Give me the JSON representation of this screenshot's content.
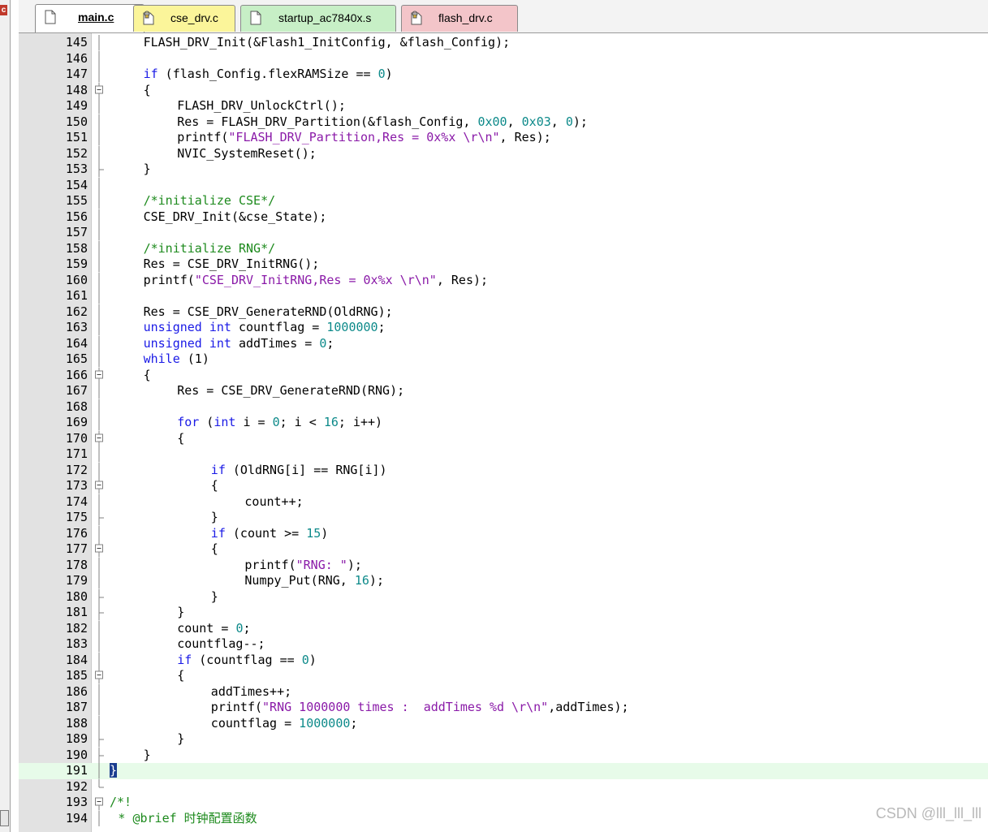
{
  "tabs": [
    {
      "label": "main.c",
      "active": true,
      "icon": "file-icon"
    },
    {
      "label": "cse_drv.c",
      "active": false,
      "icon": "locked-file-icon"
    },
    {
      "label": "startup_ac7840x.s",
      "active": false,
      "icon": "file-icon"
    },
    {
      "label": "flash_drv.c",
      "active": false,
      "icon": "locked-file-icon"
    }
  ],
  "left_badge": "c",
  "colors": {
    "keyword": "#1a1ae6",
    "number": "#0d8a8a",
    "string": "#8a1aa8",
    "comment": "#1d8a1d",
    "current_line": "#e7fbe9",
    "gutter": "#e2e2e2",
    "tab_active": "#ffffff",
    "tab_yellow": "#fbf59a",
    "tab_green": "#c7efc6",
    "tab_pink": "#f3c5c9"
  },
  "editor": {
    "current_line": 191,
    "lines": [
      {
        "n": 145,
        "fold": "line",
        "indent": 4,
        "code": [
          [
            "t",
            "FLASH_DRV_Init(&Flash1_InitConfig, &flash_Config);"
          ]
        ]
      },
      {
        "n": 146,
        "fold": "line",
        "indent": 0,
        "code": []
      },
      {
        "n": 147,
        "fold": "line",
        "indent": 4,
        "code": [
          [
            "k",
            "if"
          ],
          [
            "t",
            " (flash_Config.flexRAMSize == "
          ],
          [
            "n",
            "0"
          ],
          [
            "t",
            ")"
          ]
        ]
      },
      {
        "n": 148,
        "fold": "box",
        "indent": 4,
        "code": [
          [
            "t",
            "{"
          ]
        ]
      },
      {
        "n": 149,
        "fold": "line",
        "indent": 8,
        "code": [
          [
            "t",
            "FLASH_DRV_UnlockCtrl();"
          ]
        ]
      },
      {
        "n": 150,
        "fold": "line",
        "indent": 8,
        "code": [
          [
            "t",
            "Res = FLASH_DRV_Partition(&flash_Config, "
          ],
          [
            "n",
            "0x00"
          ],
          [
            "t",
            ", "
          ],
          [
            "n",
            "0x03"
          ],
          [
            "t",
            ", "
          ],
          [
            "n",
            "0"
          ],
          [
            "t",
            ");"
          ]
        ]
      },
      {
        "n": 151,
        "fold": "line",
        "indent": 8,
        "code": [
          [
            "t",
            "printf("
          ],
          [
            "s",
            "\"FLASH_DRV_Partition,Res = 0x%x \\r\\n\""
          ],
          [
            "t",
            ", Res);"
          ]
        ]
      },
      {
        "n": 152,
        "fold": "line",
        "indent": 8,
        "code": [
          [
            "t",
            "NVIC_SystemReset();"
          ]
        ]
      },
      {
        "n": 153,
        "fold": "end",
        "indent": 4,
        "code": [
          [
            "t",
            "}"
          ]
        ]
      },
      {
        "n": 154,
        "fold": "line",
        "indent": 0,
        "code": []
      },
      {
        "n": 155,
        "fold": "line",
        "indent": 4,
        "code": [
          [
            "c",
            "/*initialize CSE*/"
          ]
        ]
      },
      {
        "n": 156,
        "fold": "line",
        "indent": 4,
        "code": [
          [
            "t",
            "CSE_DRV_Init(&cse_State);"
          ]
        ]
      },
      {
        "n": 157,
        "fold": "line",
        "indent": 0,
        "code": []
      },
      {
        "n": 158,
        "fold": "line",
        "indent": 4,
        "code": [
          [
            "c",
            "/*initialize RNG*/"
          ]
        ]
      },
      {
        "n": 159,
        "fold": "line",
        "indent": 4,
        "code": [
          [
            "t",
            "Res = CSE_DRV_InitRNG();"
          ]
        ]
      },
      {
        "n": 160,
        "fold": "line",
        "indent": 4,
        "code": [
          [
            "t",
            "printf("
          ],
          [
            "s",
            "\"CSE_DRV_InitRNG,Res = 0x%x \\r\\n\""
          ],
          [
            "t",
            ", Res);"
          ]
        ]
      },
      {
        "n": 161,
        "fold": "line",
        "indent": 0,
        "code": []
      },
      {
        "n": 162,
        "fold": "line",
        "indent": 4,
        "code": [
          [
            "t",
            "Res = CSE_DRV_GenerateRND(OldRNG);"
          ]
        ]
      },
      {
        "n": 163,
        "fold": "line",
        "indent": 4,
        "code": [
          [
            "k",
            "unsigned int"
          ],
          [
            "t",
            " countflag = "
          ],
          [
            "n",
            "1000000"
          ],
          [
            "t",
            ";"
          ]
        ]
      },
      {
        "n": 164,
        "fold": "line",
        "indent": 4,
        "code": [
          [
            "k",
            "unsigned int"
          ],
          [
            "t",
            " addTimes = "
          ],
          [
            "n",
            "0"
          ],
          [
            "t",
            ";"
          ]
        ]
      },
      {
        "n": 165,
        "fold": "line",
        "indent": 4,
        "code": [
          [
            "k",
            "while"
          ],
          [
            "t",
            " (1)"
          ]
        ]
      },
      {
        "n": 166,
        "fold": "box",
        "indent": 4,
        "code": [
          [
            "t",
            "{"
          ]
        ]
      },
      {
        "n": 167,
        "fold": "line",
        "indent": 8,
        "code": [
          [
            "t",
            "Res = CSE_DRV_GenerateRND(RNG);"
          ]
        ]
      },
      {
        "n": 168,
        "fold": "line",
        "indent": 0,
        "code": []
      },
      {
        "n": 169,
        "fold": "line",
        "indent": 8,
        "code": [
          [
            "k",
            "for"
          ],
          [
            "t",
            " ("
          ],
          [
            "k",
            "int"
          ],
          [
            "t",
            " i = "
          ],
          [
            "n",
            "0"
          ],
          [
            "t",
            "; i < "
          ],
          [
            "n",
            "16"
          ],
          [
            "t",
            "; i++)"
          ]
        ]
      },
      {
        "n": 170,
        "fold": "box",
        "indent": 8,
        "code": [
          [
            "t",
            "{"
          ]
        ]
      },
      {
        "n": 171,
        "fold": "line",
        "indent": 0,
        "code": []
      },
      {
        "n": 172,
        "fold": "line",
        "indent": 12,
        "code": [
          [
            "k",
            "if"
          ],
          [
            "t",
            " (OldRNG[i] == RNG[i])"
          ]
        ]
      },
      {
        "n": 173,
        "fold": "box",
        "indent": 12,
        "code": [
          [
            "t",
            "{"
          ]
        ]
      },
      {
        "n": 174,
        "fold": "line",
        "indent": 16,
        "code": [
          [
            "t",
            "count++;"
          ]
        ]
      },
      {
        "n": 175,
        "fold": "end",
        "indent": 12,
        "code": [
          [
            "t",
            "}"
          ]
        ]
      },
      {
        "n": 176,
        "fold": "line",
        "indent": 12,
        "code": [
          [
            "k",
            "if"
          ],
          [
            "t",
            " (count >= "
          ],
          [
            "n",
            "15"
          ],
          [
            "t",
            ")"
          ]
        ]
      },
      {
        "n": 177,
        "fold": "box",
        "indent": 12,
        "code": [
          [
            "t",
            "{"
          ]
        ]
      },
      {
        "n": 178,
        "fold": "line",
        "indent": 16,
        "code": [
          [
            "t",
            "printf("
          ],
          [
            "s",
            "\"RNG: \""
          ],
          [
            "t",
            ");"
          ]
        ]
      },
      {
        "n": 179,
        "fold": "line",
        "indent": 16,
        "code": [
          [
            "t",
            "Numpy_Put(RNG, "
          ],
          [
            "n",
            "16"
          ],
          [
            "t",
            ");"
          ]
        ]
      },
      {
        "n": 180,
        "fold": "end",
        "indent": 12,
        "code": [
          [
            "t",
            "}"
          ]
        ]
      },
      {
        "n": 181,
        "fold": "end",
        "indent": 8,
        "code": [
          [
            "t",
            "}"
          ]
        ]
      },
      {
        "n": 182,
        "fold": "line",
        "indent": 8,
        "code": [
          [
            "t",
            "count = "
          ],
          [
            "n",
            "0"
          ],
          [
            "t",
            ";"
          ]
        ]
      },
      {
        "n": 183,
        "fold": "line",
        "indent": 8,
        "code": [
          [
            "t",
            "countflag--;"
          ]
        ]
      },
      {
        "n": 184,
        "fold": "line",
        "indent": 8,
        "code": [
          [
            "k",
            "if"
          ],
          [
            "t",
            " (countflag == "
          ],
          [
            "n",
            "0"
          ],
          [
            "t",
            ")"
          ]
        ]
      },
      {
        "n": 185,
        "fold": "box",
        "indent": 8,
        "code": [
          [
            "t",
            "{"
          ]
        ]
      },
      {
        "n": 186,
        "fold": "line",
        "indent": 12,
        "code": [
          [
            "t",
            "addTimes++;"
          ]
        ]
      },
      {
        "n": 187,
        "fold": "line",
        "indent": 12,
        "code": [
          [
            "t",
            "printf("
          ],
          [
            "s",
            "\"RNG 1000000 times :  addTimes %d \\r\\n\""
          ],
          [
            "t",
            ",addTimes);"
          ]
        ]
      },
      {
        "n": 188,
        "fold": "line",
        "indent": 12,
        "code": [
          [
            "t",
            "countflag = "
          ],
          [
            "n",
            "1000000"
          ],
          [
            "t",
            ";"
          ]
        ]
      },
      {
        "n": 189,
        "fold": "end",
        "indent": 8,
        "code": [
          [
            "t",
            "}"
          ]
        ]
      },
      {
        "n": 190,
        "fold": "end",
        "indent": 4,
        "code": [
          [
            "t",
            "}"
          ]
        ]
      },
      {
        "n": 191,
        "fold": "line",
        "indent": 0,
        "code": [
          [
            "b",
            "}"
          ]
        ]
      },
      {
        "n": 192,
        "fold": "corner",
        "indent": 0,
        "code": []
      },
      {
        "n": 193,
        "fold": "boxtop",
        "indent": 0,
        "code": [
          [
            "c",
            "/*!"
          ]
        ]
      },
      {
        "n": 194,
        "fold": "line",
        "indent": 1,
        "code": [
          [
            "c",
            "* @brief 时钟配置函数"
          ]
        ]
      }
    ]
  },
  "watermark": "CSDN @lll_lll_lll"
}
